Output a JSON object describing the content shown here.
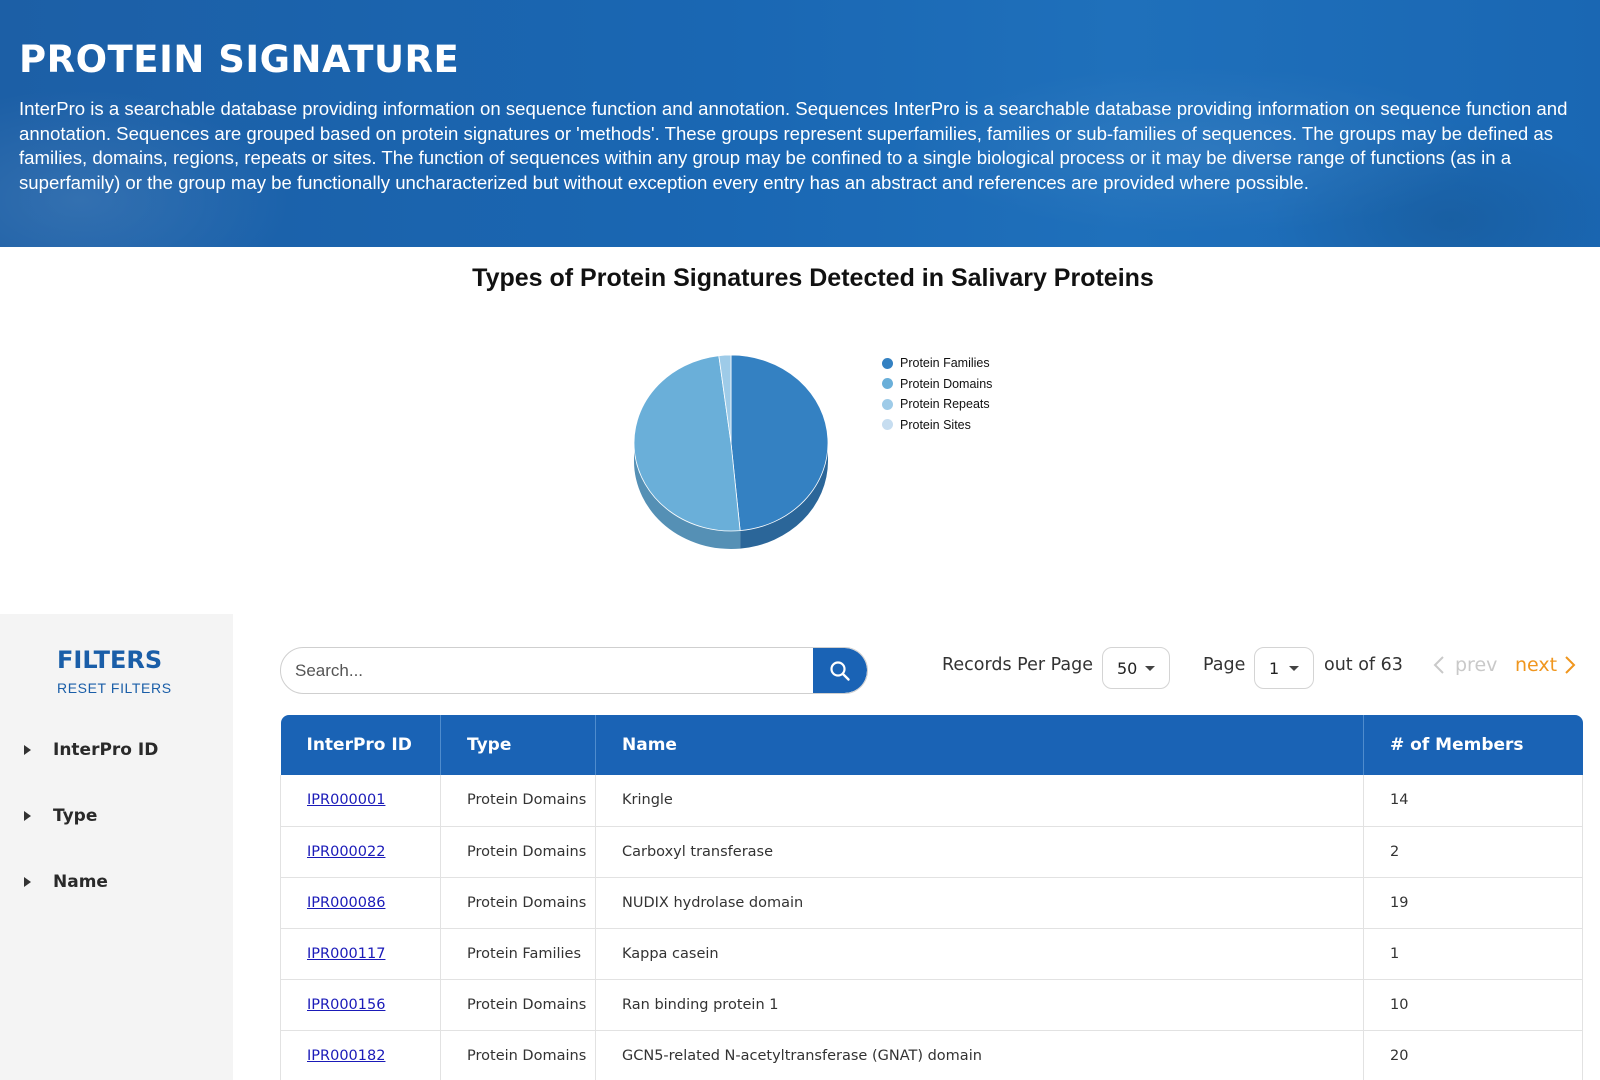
{
  "header": {
    "title": "PROTEIN SIGNATURE",
    "description": "InterPro is a searchable database providing information on sequence function and annotation. Sequences InterPro is a searchable database providing information on sequence function and annotation. Sequences are grouped based on protein signatures or 'methods'. These groups represent superfamilies, families or sub-families of sequences. The groups may be defined as families, domains, regions, repeats or sites. The function of sequences within any group may be confined to a single biological process or it may be diverse range of functions (as in a superfamily) or the group may be functionally uncharacterized but without exception every entry has an abstract and references are provided where possible."
  },
  "chart_data": {
    "type": "pie",
    "title": "Types of Protein Signatures Detected in Salivary Proteins",
    "legend_placement": "right",
    "categories": [
      "Protein Families",
      "Protein Domains",
      "Protein Repeats",
      "Protein Sites"
    ],
    "values": [
      48.5,
      49.5,
      2.0,
      0.0
    ],
    "colors": [
      "#3481c2",
      "#6aafd9",
      "#9ecbe8",
      "#c6ddf0"
    ],
    "side_colors": [
      "#2b6699",
      "#5590b5",
      "#7ea9c5",
      "#a6bfd3"
    ]
  },
  "filters": {
    "title": "FILTERS",
    "reset_label": "RESET FILTERS",
    "items": [
      {
        "label": "InterPro ID"
      },
      {
        "label": "Type"
      },
      {
        "label": "Name"
      }
    ]
  },
  "search": {
    "placeholder": "Search...",
    "icon": "search-icon"
  },
  "pagination": {
    "records_label": "Records Per Page",
    "records_value": "50",
    "page_label": "Page",
    "page_value": "1",
    "out_of": "out of 63",
    "prev": "prev",
    "next": "next"
  },
  "table": {
    "columns": [
      "InterPro ID",
      "Type",
      "Name",
      "# of Members"
    ],
    "rows": [
      [
        "IPR000001",
        "Protein Domains",
        "Kringle",
        "14"
      ],
      [
        "IPR000022",
        "Protein Domains",
        "Carboxyl transferase",
        "2"
      ],
      [
        "IPR000086",
        "Protein Domains",
        "NUDIX hydrolase domain",
        "19"
      ],
      [
        "IPR000117",
        "Protein Families",
        "Kappa casein",
        "1"
      ],
      [
        "IPR000156",
        "Protein Domains",
        "Ran binding protein 1",
        "10"
      ],
      [
        "IPR000182",
        "Protein Domains",
        "GCN5-related N-acetyltransferase (GNAT) domain",
        "20"
      ]
    ]
  },
  "colors": {
    "brand_blue": "#1a63b5",
    "next_orange": "#f0961e",
    "link_blue": "#1a1ab8"
  }
}
